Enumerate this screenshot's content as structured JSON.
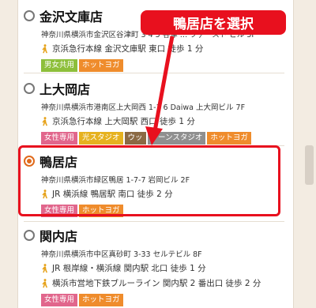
{
  "callout": {
    "text": "鴨居店を選択"
  },
  "stores": [
    {
      "name": "金沢文庫店",
      "address": "神奈川県横浜市金沢区谷津町 3 4 5 谷津 … ファースト ビル 5F",
      "access": [
        "京浜急行本線 金沢文庫駅 東口 徒歩 1 分"
      ],
      "tags": [
        {
          "label": "男女共用",
          "color": "#8dbf3a"
        },
        {
          "label": "ホットヨガ",
          "color": "#ef8c2c"
        }
      ],
      "selected": false
    },
    {
      "name": "上大岡店",
      "address": "神奈川県横浜市港南区上大岡西 1-1 6 Daiwa 上大岡ビル 7F",
      "access": [
        "京浜急行本線 上大岡駅 西口 徒歩 1 分"
      ],
      "tags": [
        {
          "label": "女性専用",
          "color": "#e1668c"
        },
        {
          "label": "光スタジオ",
          "color": "#e6b21f"
        },
        {
          "label": "ウッ",
          "color": "#8b6a44"
        },
        {
          "label": "トーンスタジオ",
          "color": "#8f8f8f"
        },
        {
          "label": "ホットヨガ",
          "color": "#ef8c2c"
        }
      ],
      "selected": false
    },
    {
      "name": "鴨居店",
      "address": "神奈川県横浜市緑区鴨居 1-7-7 岩岡ビル 2F",
      "access": [
        "JR 横浜線 鴨居駅 南口 徒歩 2 分"
      ],
      "tags": [
        {
          "label": "女性専用",
          "color": "#e1668c"
        },
        {
          "label": "ホットヨガ",
          "color": "#ef8c2c"
        }
      ],
      "selected": true
    },
    {
      "name": "関内店",
      "address": "神奈川県横浜市中区真砂町 3-33 セルテビル 8F",
      "access": [
        "JR 根岸線・横浜線 関内駅 北口 徒歩 1 分",
        "横浜市営地下鉄ブルーライン 関内駅 2 番出口 徒歩 2 分"
      ],
      "tags": [
        {
          "label": "女性専用",
          "color": "#e1668c"
        },
        {
          "label": "ホットヨガ",
          "color": "#ef8c2c"
        }
      ],
      "selected": false
    }
  ]
}
